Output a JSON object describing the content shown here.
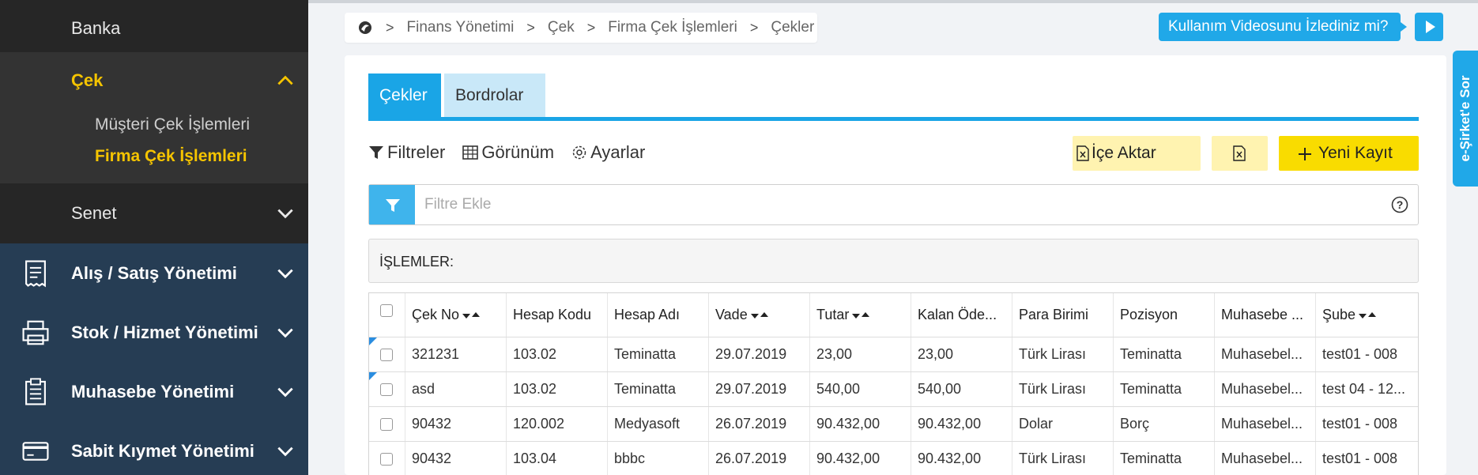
{
  "sidebar": {
    "banka": "Banka",
    "cek": "Çek",
    "cek_sub": [
      "Müşteri Çek İşlemleri",
      "Firma Çek İşlemleri"
    ],
    "senet": "Senet",
    "main": [
      "Alış / Satış Yönetimi",
      "Stok / Hizmet Yönetimi",
      "Muhasebe Yönetimi",
      "Sabit Kıymet Yönetimi"
    ]
  },
  "breadcrumb": [
    "Finans Yönetimi",
    "Çek",
    "Firma Çek İşlemleri",
    "Çekler"
  ],
  "video_button": "Kullanım Videosunu İzlediniz mi?",
  "side_tab": "e-Şirket'e Sor",
  "tabs": [
    "Çekler",
    "Bordrolar"
  ],
  "toolbar": {
    "filters": "Filtreler",
    "view": "Görünüm",
    "settings": "Ayarlar"
  },
  "buttons": {
    "import": "İçe Aktar",
    "new": "Yeni Kayıt"
  },
  "filter": {
    "placeholder": "Filtre Ekle"
  },
  "ops_label": "İŞLEMLER:",
  "table": {
    "headers": [
      "Çek No",
      "Hesap Kodu",
      "Hesap Adı",
      "Vade",
      "Tutar",
      "Kalan Öde...",
      "Para Birimi",
      "Pozisyon",
      "Muhasebe ...",
      "Şube"
    ],
    "rows": [
      [
        "321231",
        "103.02",
        "Teminatta",
        "29.07.2019",
        "23,00",
        "23,00",
        "Türk Lirası",
        "Teminatta",
        "Muhasebel...",
        "test01 - 008"
      ],
      [
        "asd",
        "103.02",
        "Teminatta",
        "29.07.2019",
        "540,00",
        "540,00",
        "Türk Lirası",
        "Teminatta",
        "Muhasebel...",
        "test 04 - 12..."
      ],
      [
        "90432",
        "120.002",
        "Medyasoft",
        "26.07.2019",
        "90.432,00",
        "90.432,00",
        "Dolar",
        "Borç",
        "Muhasebel...",
        "test01 - 008"
      ],
      [
        "90432",
        "103.04",
        "bbbc",
        "26.07.2019",
        "90.432,00",
        "90.432,00",
        "Türk Lirası",
        "Teminatta",
        "Muhasebel...",
        "test01 - 008"
      ]
    ]
  },
  "colors": {
    "accent": "#1aa5e6",
    "highlight": "#f5c400",
    "sidebar": "#263d54",
    "new_button": "#f9dc00"
  }
}
